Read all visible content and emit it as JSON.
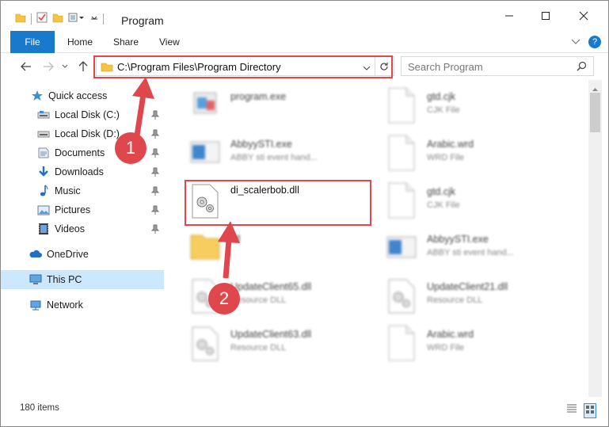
{
  "window": {
    "title": "Program"
  },
  "ribbon": {
    "tabs": [
      "File",
      "Home",
      "Share",
      "View"
    ]
  },
  "address": {
    "path": "C:\\Program Files\\Program Directory",
    "search_placeholder": "Search Program"
  },
  "nav": {
    "items": [
      {
        "label": "Quick access",
        "icon": "star-icon"
      },
      {
        "label": "Local Disk (C:)",
        "icon": "drive-icon"
      },
      {
        "label": "Local Disk (D:)",
        "icon": "drive-icon"
      },
      {
        "label": "Documents",
        "icon": "documents-icon"
      },
      {
        "label": "Downloads",
        "icon": "download-icon"
      },
      {
        "label": "Music",
        "icon": "music-icon"
      },
      {
        "label": "Pictures",
        "icon": "pictures-icon"
      },
      {
        "label": "Videos",
        "icon": "videos-icon"
      },
      {
        "label": "OneDrive",
        "icon": "cloud-icon"
      },
      {
        "label": "This PC",
        "icon": "computer-icon"
      },
      {
        "label": "Network",
        "icon": "network-icon"
      }
    ]
  },
  "files": [
    {
      "name": "program.exe",
      "type": ""
    },
    {
      "name": "gtd.cjk",
      "type": "CJK File"
    },
    {
      "name": "AbbyySTI.exe",
      "type": "ABBY sti event hand..."
    },
    {
      "name": "Arabic.wrd",
      "type": "WRD File"
    },
    {
      "name": "di_scalerbob.dll",
      "type": ""
    },
    {
      "name": "gtd.cjk",
      "type": "CJK File"
    },
    {
      "name": "dll",
      "type": ""
    },
    {
      "name": "AbbyySTI.exe",
      "type": "ABBY sti event hand..."
    },
    {
      "name": "UpdateClient65.dll",
      "type": "Resource DLL"
    },
    {
      "name": "UpdateClient21.dll",
      "type": "Resource DLL"
    },
    {
      "name": "UpdateClient63.dll",
      "type": "Resource DLL"
    },
    {
      "name": "Arabic.wrd",
      "type": "WRD File"
    }
  ],
  "status": {
    "count": "180 items"
  },
  "annotations": {
    "step1": "1",
    "step2": "2"
  },
  "colors": {
    "accent": "#1979ca",
    "annotation": "#e0474c",
    "selected": "#cce8ff"
  }
}
